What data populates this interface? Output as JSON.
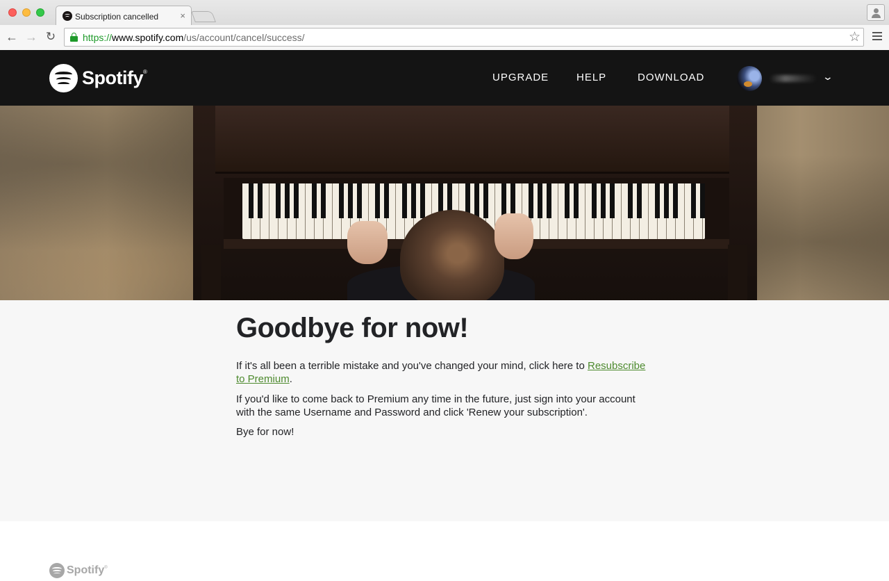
{
  "browser": {
    "tab_title": "Subscription cancelled",
    "tab_close": "×",
    "url_scheme": "https://",
    "url_host": "www.spotify.com",
    "url_path": "/us/account/cancel/success/",
    "icons": {
      "back": "back-arrow-icon",
      "forward": "forward-arrow-icon",
      "reload": "reload-icon",
      "lock": "lock-icon",
      "bookmark": "star-icon",
      "menu": "hamburger-menu-icon",
      "profile": "person-icon"
    },
    "back_glyph": "←",
    "forward_glyph": "→",
    "reload_glyph": "↻",
    "star_glyph": "☆"
  },
  "header": {
    "logo_text": "Spotify",
    "logo_tm": "®",
    "nav": {
      "upgrade": "UPGRADE",
      "help": "HELP",
      "download": "DOWNLOAD"
    },
    "user_chevron": "⌄"
  },
  "main": {
    "headline": "Goodbye for now!",
    "p1_text": "If it's all been a terrible mistake and you've changed your mind, click here to ",
    "p1_link": "Resubscribe to Premium",
    "p1_end": ".",
    "p2": "If you'd like to come back to Premium any time in the future, just sign into your account with the same Username and Password and click 'Renew your subscription'.",
    "p3": "Bye for now!"
  },
  "footer": {
    "logo_text": "Spotify",
    "logo_tm": "®"
  },
  "colors": {
    "header_bg": "#141414",
    "content_bg": "#f7f7f7",
    "link": "#4d8a2e",
    "secure_green": "#1e9a2a"
  }
}
